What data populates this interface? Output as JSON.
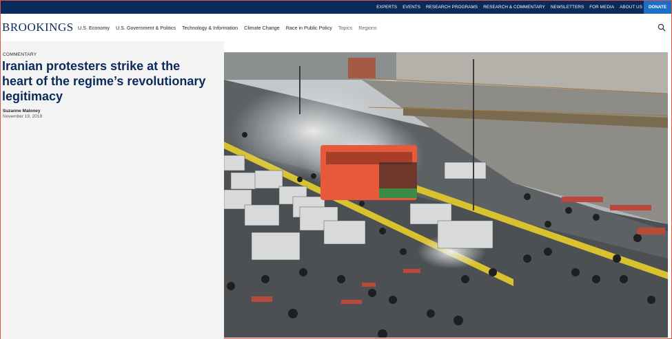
{
  "topbar": {
    "links": [
      "EXPERTS",
      "EVENTS",
      "RESEARCH PROGRAMS",
      "RESEARCH & COMMENTARY",
      "NEWSLETTERS",
      "FOR MEDIA",
      "ABOUT US"
    ],
    "donate": "DONATE"
  },
  "nav": {
    "logo": "BROOKINGS",
    "items": [
      "U.S. Economy",
      "U.S. Government & Politics",
      "Technology & Information",
      "Climate Change",
      "Race in Public Policy",
      "Topics",
      "Regions"
    ],
    "search_icon": "search-icon"
  },
  "article": {
    "kicker": "COMMENTARY",
    "headline": "Iranian protesters strike at the heart of the regime’s revolutionary legitimacy",
    "author": "Suzanne Maloney",
    "date": "November 19, 2019"
  },
  "colors": {
    "navy": "#0a2a5a",
    "donate": "#1d6fc4",
    "bus": "#e8593a"
  }
}
